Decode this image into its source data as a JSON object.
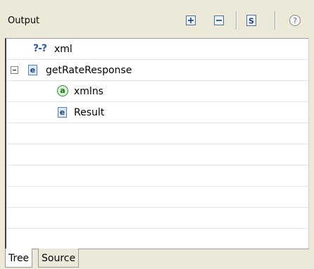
{
  "panel": {
    "title": "Output"
  },
  "toolbar": {
    "buttons": [
      {
        "name": "expand-all",
        "icon": "expand-all-icon"
      },
      {
        "name": "collapse-all",
        "icon": "collapse-all-icon"
      },
      {
        "name": "schema",
        "icon": "schema-s-icon",
        "glyph": "S"
      },
      {
        "name": "help",
        "icon": "help-icon",
        "glyph": "?"
      }
    ]
  },
  "tree": {
    "rows": [
      {
        "kind": "processing-instruction",
        "icon_glyph": "?-?",
        "label": "xml"
      },
      {
        "kind": "element",
        "icon_glyph": "e",
        "label": "getRateResponse",
        "expanded": true
      },
      {
        "kind": "attribute",
        "icon_glyph": "a",
        "label": "xmlns"
      },
      {
        "kind": "element",
        "icon_glyph": "e",
        "label": "Result"
      }
    ]
  },
  "tabs": [
    {
      "label": "Tree",
      "active": true
    },
    {
      "label": "Source",
      "active": false
    }
  ],
  "colors": {
    "panel_bg": "#ece9d8",
    "element_icon_border": "#4b86b7",
    "attribute_icon": "#3d8a3d",
    "pi_icon": "#2d5fa8"
  }
}
